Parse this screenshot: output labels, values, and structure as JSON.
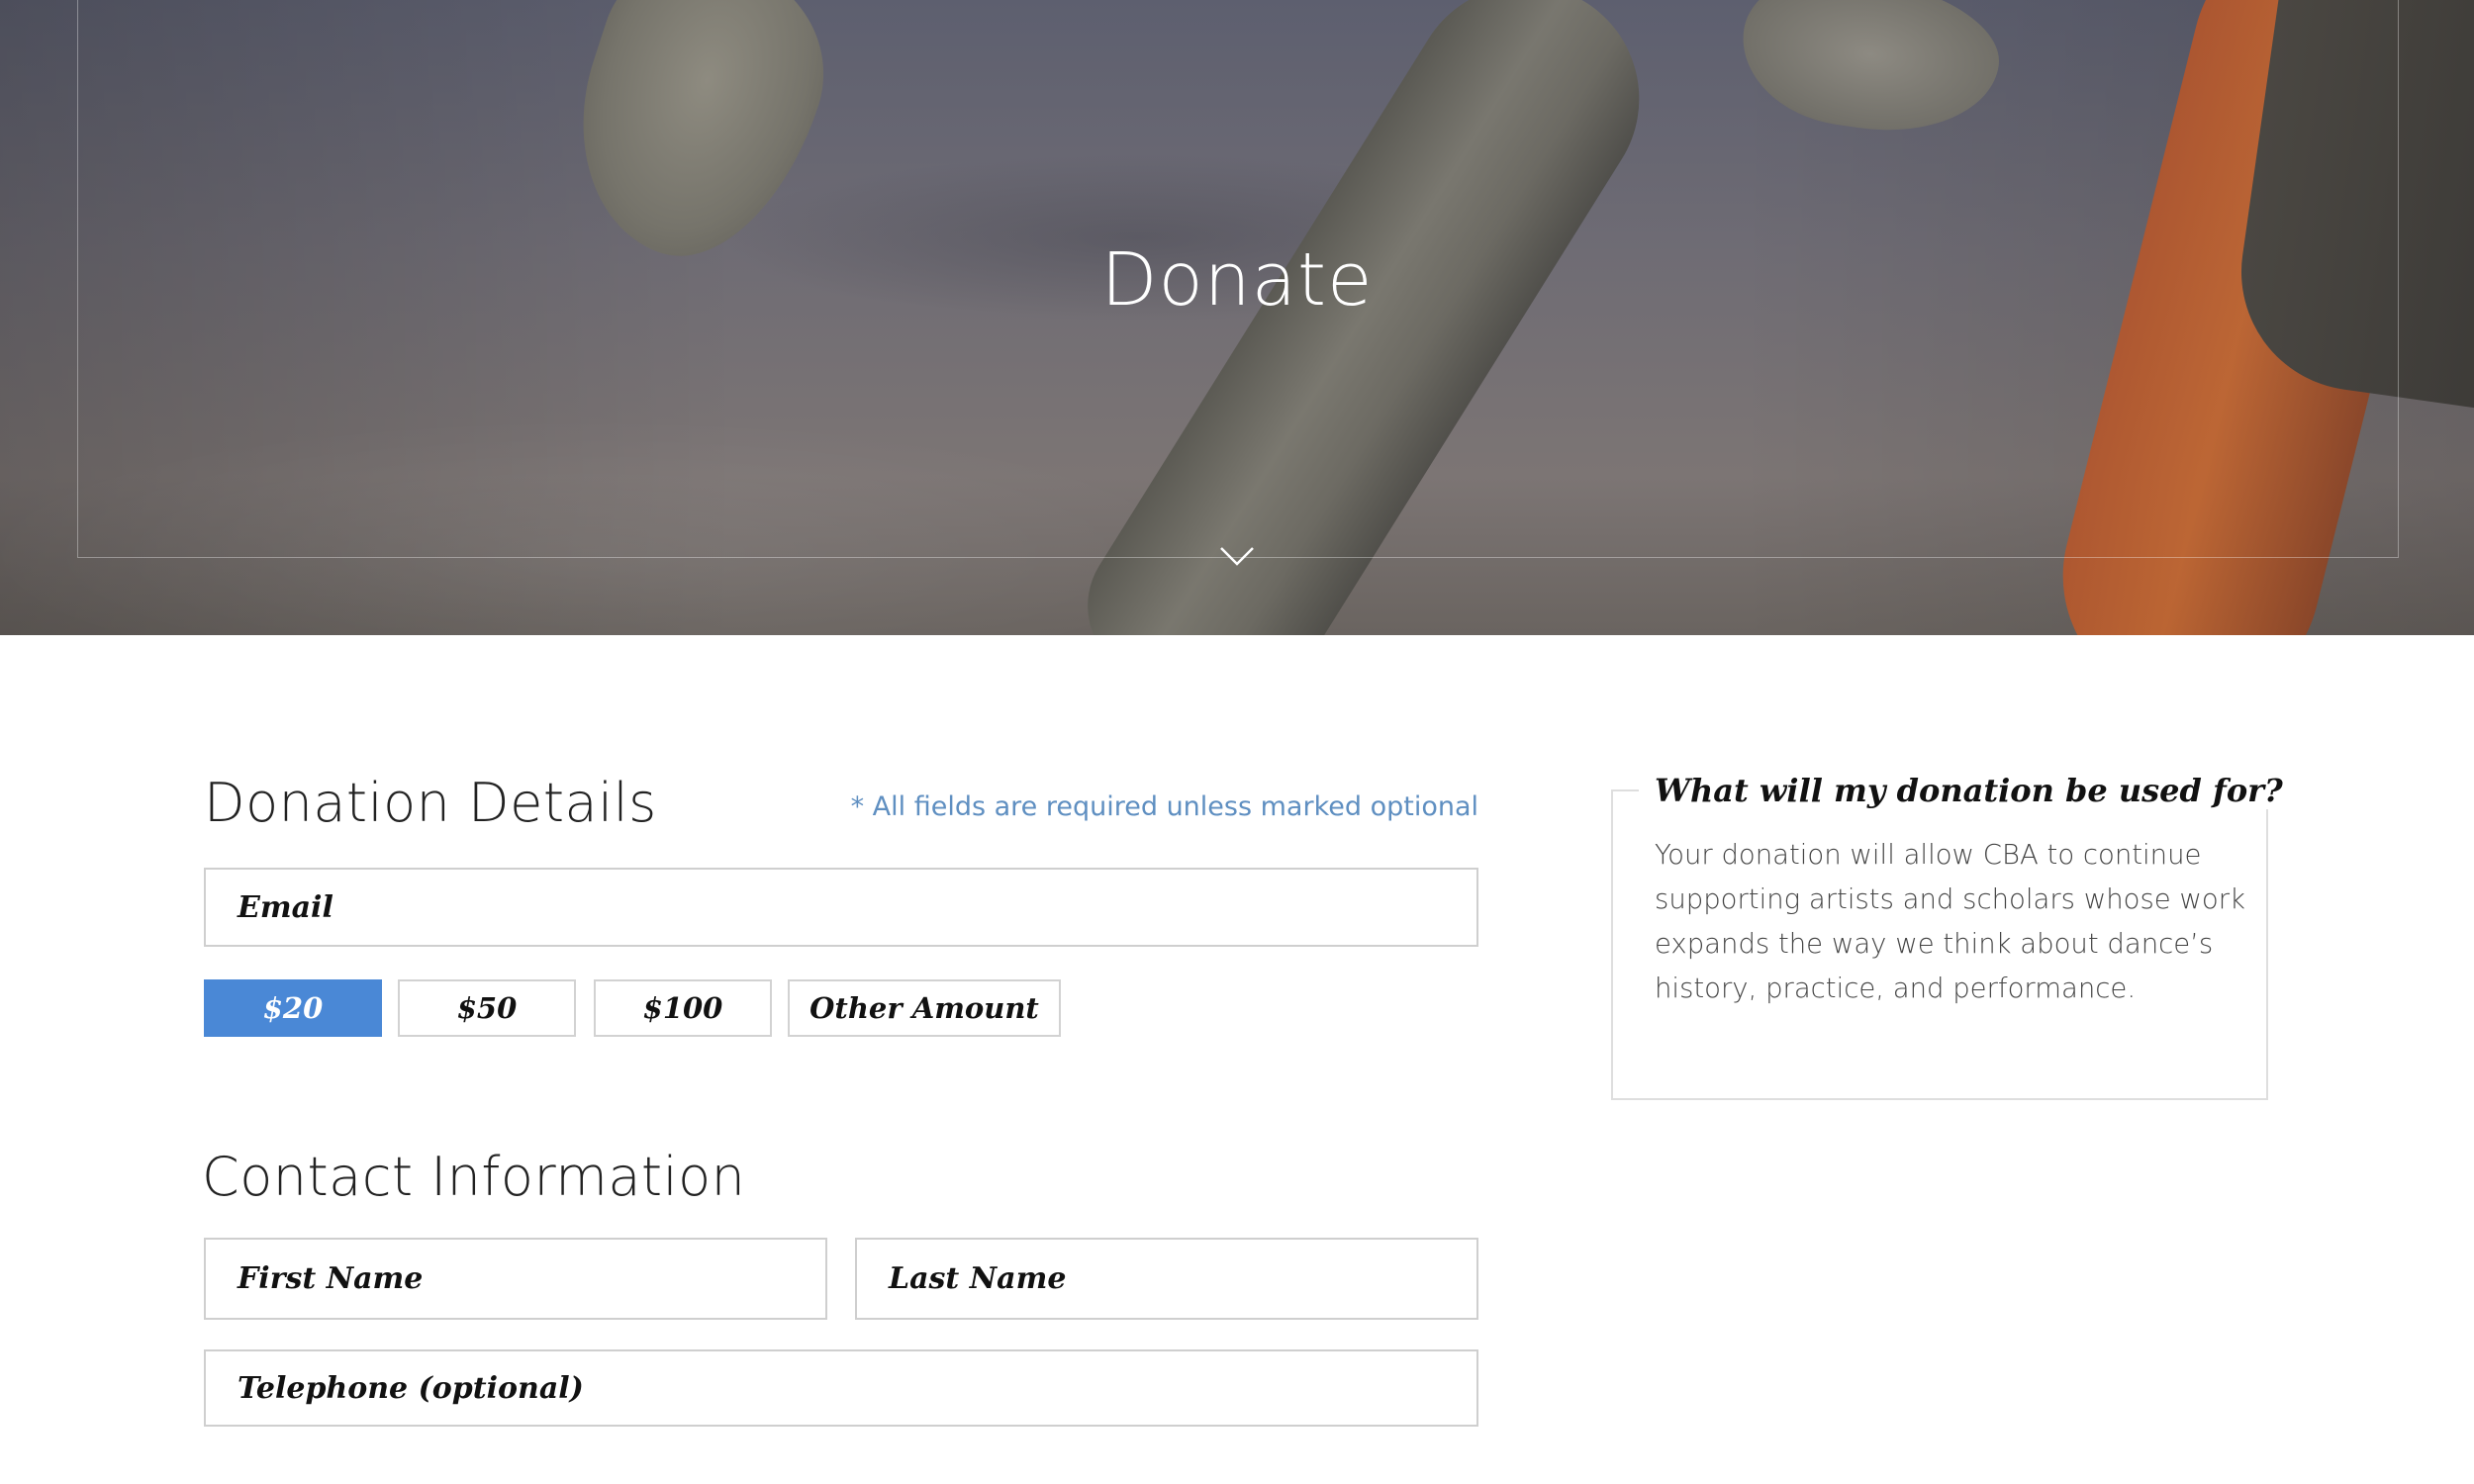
{
  "hero": {
    "title": "Donate"
  },
  "donation": {
    "heading": "Donation Details",
    "required_note": "* All fields are required unless marked optional",
    "email_placeholder": "Email",
    "amounts": [
      "$20",
      "$50",
      "$100",
      "Other Amount"
    ],
    "selected_amount": "$20"
  },
  "contact": {
    "heading": "Contact Information",
    "first_name_placeholder": "First Name",
    "last_name_placeholder": "Last Name",
    "telephone_placeholder": "Telephone (optional)"
  },
  "info": {
    "title": "What will my donation be used for?",
    "body": "Your donation will allow CBA to continue supporting artists and scholars whose work expands the way we think about dance’s history, practice, and performance."
  },
  "colors": {
    "accent": "#4a88d6",
    "note": "#5f8fc1"
  },
  "icons": {
    "scroll_down": "chevron-down-icon"
  }
}
